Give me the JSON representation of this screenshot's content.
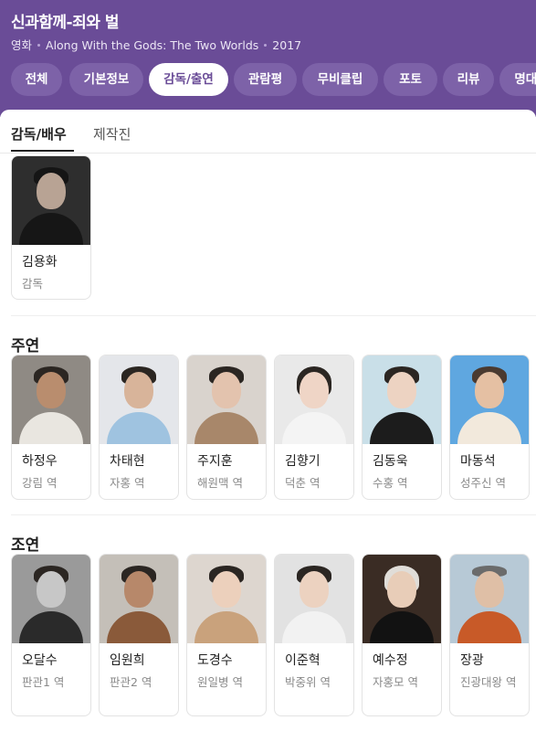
{
  "header": {
    "title": "신과함께-죄와 벌",
    "meta": [
      "영화",
      "Along With the Gods: The Two Worlds",
      "2017"
    ]
  },
  "tabs": [
    {
      "label": "전체",
      "active": false
    },
    {
      "label": "기본정보",
      "active": false
    },
    {
      "label": "감독/출연",
      "active": true
    },
    {
      "label": "관람평",
      "active": false
    },
    {
      "label": "무비클립",
      "active": false
    },
    {
      "label": "포토",
      "active": false
    },
    {
      "label": "리뷰",
      "active": false
    },
    {
      "label": "명대사",
      "active": false
    }
  ],
  "subtabs": [
    {
      "label": "감독/배우",
      "active": true
    },
    {
      "label": "제작진",
      "active": false
    }
  ],
  "director": {
    "name": "김용화",
    "role": "감독"
  },
  "lead": {
    "title": "주연",
    "cast": [
      {
        "name": "하정우",
        "role": "강림 역"
      },
      {
        "name": "차태현",
        "role": "자홍 역"
      },
      {
        "name": "주지훈",
        "role": "해원맥 역"
      },
      {
        "name": "김향기",
        "role": "덕춘 역"
      },
      {
        "name": "김동욱",
        "role": "수홍 역"
      },
      {
        "name": "마동석",
        "role": "성주신 역"
      }
    ]
  },
  "supporting": {
    "title": "조연",
    "cast": [
      {
        "name": "오달수",
        "role": "판관1 역"
      },
      {
        "name": "임원희",
        "role": "판관2 역"
      },
      {
        "name": "도경수",
        "role": "원일병 역"
      },
      {
        "name": "이준혁",
        "role": "박중위 역"
      },
      {
        "name": "예수정",
        "role": "자홍모 역"
      },
      {
        "name": "장광",
        "role": "진광대왕 역"
      }
    ]
  },
  "colors": {
    "header_bg": "#6a4c97",
    "tab_bg": "#7d62a8"
  }
}
